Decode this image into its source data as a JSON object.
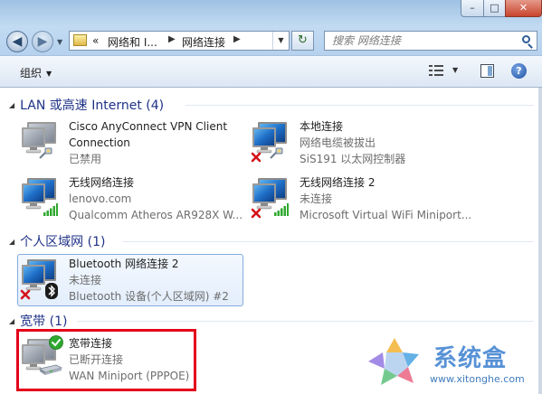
{
  "window": {
    "min_label": "–",
    "max_label": "□",
    "close_label": "✕"
  },
  "nav": {
    "back_label": "◀",
    "forward_label": "▶",
    "address": {
      "overflow": "«",
      "crumb1": "网络和 I...",
      "crumb2": "网络连接"
    },
    "refresh_label": "↻",
    "search": {
      "placeholder": "搜索 网络连接"
    }
  },
  "toolbar": {
    "organize_label": "组织",
    "help_label": "?"
  },
  "groups": [
    {
      "title": "LAN 或高速 Internet (4)"
    },
    {
      "title": "个人区域网 (1)"
    },
    {
      "title": "宽带 (1)"
    }
  ],
  "items": [
    {
      "name": "Cisco AnyConnect VPN Client",
      "name2": "Connection",
      "status": "已禁用",
      "device": ""
    },
    {
      "name": "本地连接",
      "name2": "",
      "status": "网络电缆被拔出",
      "device": "SiS191 以太网控制器"
    },
    {
      "name": "无线网络连接",
      "name2": "",
      "status": "lenovo.com",
      "device": "Qualcomm Atheros AR928X W..."
    },
    {
      "name": "无线网络连接 2",
      "name2": "",
      "status": "未连接",
      "device": "Microsoft Virtual WiFi Miniport..."
    },
    {
      "name": "Bluetooth 网络连接 2",
      "name2": "",
      "status": "未连接",
      "device": "Bluetooth 设备(个人区域网) #2"
    },
    {
      "name": "宽带连接",
      "name2": "",
      "status": "已断开连接",
      "device": "WAN Miniport (PPPOE)"
    }
  ],
  "watermark": {
    "title": "系统盒",
    "url": "www.xitonghe.com"
  },
  "colors": {
    "group_header": "#1e3287",
    "highlight_border": "#e3001a",
    "status_ok": "#2fa82f",
    "status_error": "#d4121a"
  },
  "icons": {
    "computer": "network-computer-icon",
    "error": "red-x-icon",
    "ok": "green-check-icon",
    "signal": "wireless-signal-icon",
    "bluetooth": "bluetooth-icon",
    "cable": "network-cable-icon",
    "modem": "modem-icon"
  }
}
